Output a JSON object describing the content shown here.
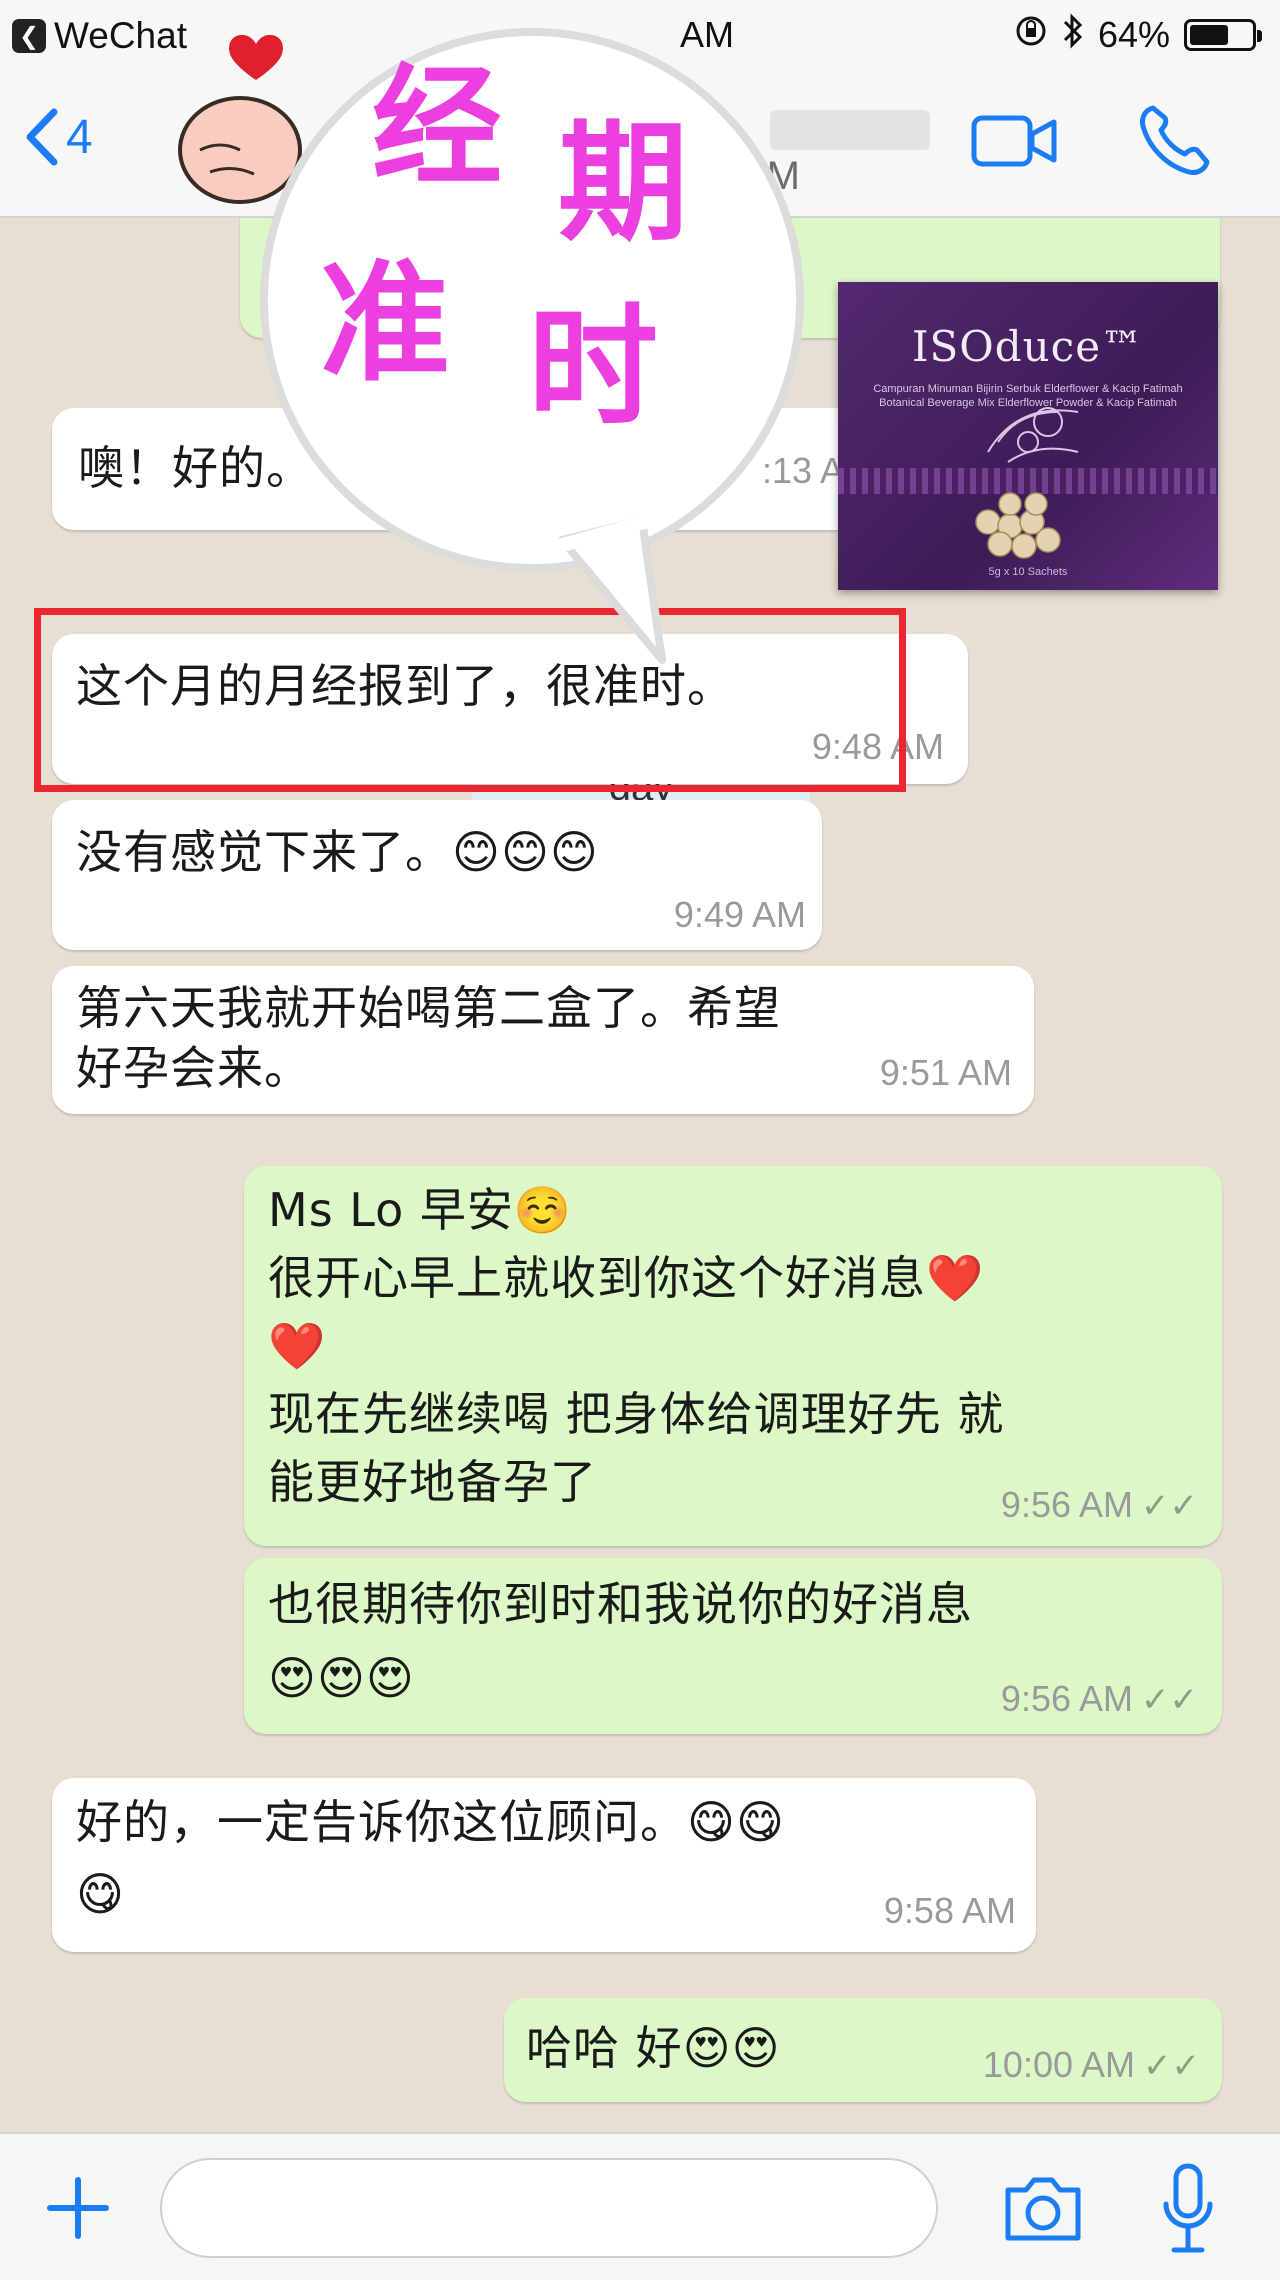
{
  "status_bar": {
    "back_app": "WeChat",
    "back_glyph": "❮",
    "time": "AM",
    "battery": "64%",
    "battery_level": 0.64,
    "icons": [
      "orientation-lock-icon",
      "bluetooth-icon",
      "battery-icon"
    ]
  },
  "nav": {
    "back_count": "4",
    "contact_last_seen_time": "AM",
    "icons": [
      "back-chevron-icon",
      "video-call-icon",
      "phone-call-icon"
    ]
  },
  "overlay": {
    "stamp_line1": [
      "经",
      "期"
    ],
    "stamp_line2": [
      "准",
      "时"
    ],
    "stamp_color": "#ec3fe0",
    "highlight_color": "#ea2730"
  },
  "product": {
    "brand": "ISOduce™",
    "fine_print": "Campuran Minuman Bijirin Serbuk Elderflower & Kacip Fatimah Botanical Beverage Mix Elderflower Powder & Kacip Fatimah",
    "net": "5g x 10 Sachets"
  },
  "messages": [
    {
      "id": "m1",
      "side": "in",
      "text": "噢！好的。",
      "time": ":13 AM"
    },
    {
      "id": "date",
      "side": "system",
      "text": "day"
    },
    {
      "id": "m2",
      "side": "in",
      "text": "这个月的月经报到了，很准时。",
      "time": "9:48 AM"
    },
    {
      "id": "m3",
      "side": "in",
      "text": "没有感觉下来了。😊😊😊",
      "time": "9:49 AM"
    },
    {
      "id": "m4",
      "side": "in",
      "lines": [
        "第六天我就开始喝第二盒了。希望",
        "好孕会来。"
      ],
      "time": "9:51 AM"
    },
    {
      "id": "m5",
      "side": "out",
      "lines": [
        "Ms Lo 早安☺️",
        "很开心早上就收到你这个好消息❤️",
        "❤️",
        "现在先继续喝 把身体给调理好先 就",
        "能更好地备孕了"
      ],
      "time": "9:56 AM",
      "ticks": "✓✓"
    },
    {
      "id": "m6",
      "side": "out",
      "lines": [
        "也很期待你到时和我说你的好消息",
        "😍😍😍"
      ],
      "time": "9:56 AM",
      "ticks": "✓✓"
    },
    {
      "id": "m7",
      "side": "in",
      "lines": [
        "好的，一定告诉你这位顾问。😋😋",
        "😋"
      ],
      "time": "9:58 AM"
    },
    {
      "id": "m8",
      "side": "out",
      "text": "哈哈 好😍😍",
      "time": "10:00 AM",
      "ticks": "✓✓"
    }
  ],
  "input": {
    "placeholder": "",
    "icons": [
      "plus-icon",
      "camera-icon",
      "microphone-icon"
    ]
  },
  "colors": {
    "accent": "#1b7cf6",
    "incoming": "#ffffff",
    "outgoing": "#dcf8c6",
    "chat_bg": "#e6dfd2"
  }
}
